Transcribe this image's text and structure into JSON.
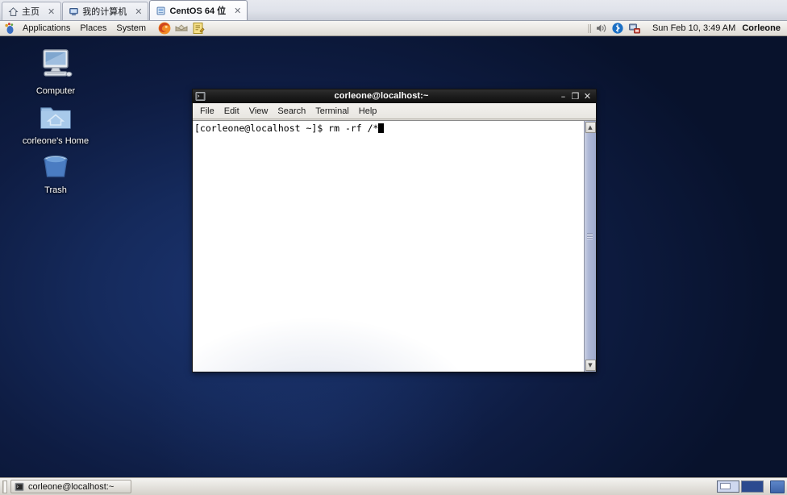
{
  "vm_tabs": [
    {
      "label": "主页",
      "icon": "home-icon",
      "active": false,
      "closable": true
    },
    {
      "label": "我的计算机",
      "icon": "computer-icon",
      "active": false,
      "closable": true
    },
    {
      "label": "CentOS 64 位",
      "icon": "vm-icon",
      "active": true,
      "closable": true
    }
  ],
  "tab_close_glyph": "✕",
  "top_panel": {
    "menus": [
      "Applications",
      "Places",
      "System"
    ],
    "launchers": [
      "firefox-icon",
      "email-icon",
      "text-editor-icon"
    ],
    "tray": [
      "volume-icon",
      "bluetooth-icon",
      "network-icon"
    ],
    "clock": "Sun Feb 10,  3:49 AM",
    "user": "Corleone"
  },
  "desktop": {
    "icons": [
      {
        "label": "Computer",
        "icon": "computer-desktop-icon"
      },
      {
        "label": "corleone's Home",
        "icon": "home-folder-icon"
      },
      {
        "label": "Trash",
        "icon": "trash-icon"
      }
    ]
  },
  "terminal": {
    "title": "corleone@localhost:~",
    "window_icon": "terminal-icon",
    "buttons": {
      "minimize": "–",
      "maximize": "❐",
      "close": "✕"
    },
    "menu": [
      "File",
      "Edit",
      "View",
      "Search",
      "Terminal",
      "Help"
    ],
    "prompt": "[corleone@localhost ~]$ ",
    "command": "rm -rf /*",
    "scroll_up_glyph": "▲",
    "scroll_down_glyph": "▼"
  },
  "bottom_panel": {
    "tasks": [
      {
        "label": "corleone@localhost:~",
        "icon": "terminal-icon"
      }
    ],
    "workspaces": [
      {
        "name": "workspace-1",
        "active": true
      },
      {
        "name": "workspace-2",
        "active": false
      }
    ],
    "trash_applet": "trash-applet-icon"
  },
  "colors": {
    "desktop_blue": "#15285a",
    "panel_gray": "#ece9e4",
    "titlebar_black": "#1d1d1d",
    "terminal_bg": "#ffffff",
    "terminal_fg": "#000000"
  }
}
